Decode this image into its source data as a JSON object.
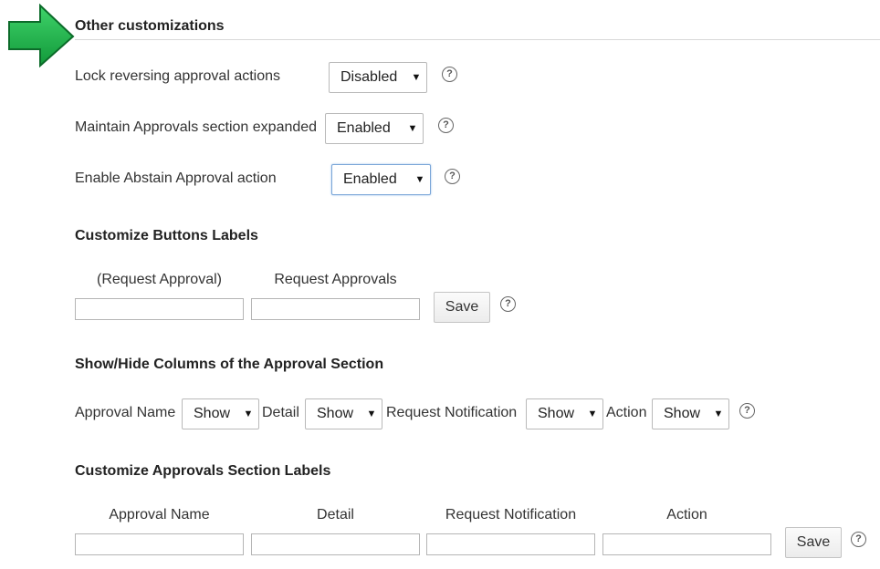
{
  "section": {
    "title": "Other customizations"
  },
  "settings": [
    {
      "label": "Lock reversing approval actions",
      "value": "Disabled"
    },
    {
      "label": "Maintain Approvals section expanded",
      "value": "Enabled"
    },
    {
      "label": "Enable Abstain Approval action",
      "value": "Enabled"
    }
  ],
  "buttons_labels": {
    "title": "Customize Buttons Labels",
    "fields": [
      {
        "label": "(Request Approval)",
        "value": ""
      },
      {
        "label": "Request Approvals",
        "value": ""
      }
    ],
    "save_label": "Save"
  },
  "columns": {
    "title": "Show/Hide Columns of the Approval Section",
    "items": [
      {
        "label": "Approval Name",
        "value": "Show"
      },
      {
        "label": "Detail",
        "value": "Show"
      },
      {
        "label": "Request Notification",
        "value": "Show"
      },
      {
        "label": "Action",
        "value": "Show"
      }
    ]
  },
  "section_labels": {
    "title": "Customize Approvals Section Labels",
    "fields": [
      {
        "label": "Approval Name",
        "value": ""
      },
      {
        "label": "Detail",
        "value": ""
      },
      {
        "label": "Request Notification",
        "value": ""
      },
      {
        "label": "Action",
        "value": ""
      }
    ],
    "save_label": "Save"
  },
  "help_glyph": "?",
  "caret_glyph": "▼",
  "colors": {
    "arrow_fill": "#1fb84a",
    "arrow_stroke": "#0c6b2a",
    "focus_border": "#7aa6d8"
  }
}
